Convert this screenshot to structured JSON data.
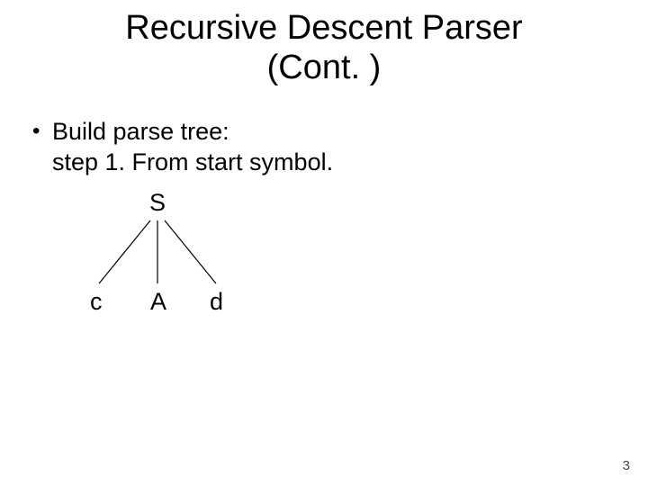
{
  "title_line1": "Recursive Descent Parser",
  "title_line2": "(Cont. )",
  "bullet1": "Build parse tree:",
  "step_line": "step 1. From start symbol.",
  "tree": {
    "root": "S",
    "child_left": "c",
    "child_mid": "A",
    "child_right": "d"
  },
  "page_number": "3"
}
